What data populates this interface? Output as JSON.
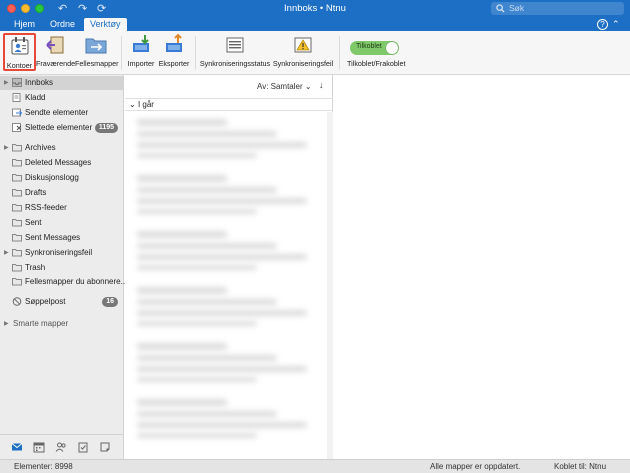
{
  "window": {
    "title": "Innboks • Ntnu",
    "search_placeholder": "Søk"
  },
  "tabs": [
    {
      "label": "Hjem",
      "active": false
    },
    {
      "label": "Ordne",
      "active": false
    },
    {
      "label": "Verktøy",
      "active": true
    }
  ],
  "ribbon": {
    "accounts": "Kontoer",
    "out_of_office": "Fraværende",
    "public_folders": "Fellesmapper",
    "import": "Importer",
    "export": "Eksporter",
    "sync_status": "Synkroniseringsstatus",
    "sync_errors": "Synkroniseringsfeil",
    "online_toggle": {
      "state_label": "Tilkoblet",
      "caption": "Tilkoblet/Frakoblet",
      "on": true
    }
  },
  "folders": [
    {
      "name": "Innboks",
      "icon": "inbox-icon",
      "selected": true,
      "disclosure": true,
      "badge": ""
    },
    {
      "name": "Kladd",
      "icon": "draft-icon",
      "selected": false,
      "disclosure": false,
      "badge": ""
    },
    {
      "name": "Sendte elementer",
      "icon": "sent-icon",
      "selected": false,
      "disclosure": false,
      "badge": ""
    },
    {
      "name": "Slettede elementer",
      "icon": "trash-icon",
      "selected": false,
      "disclosure": false,
      "badge": "1195"
    },
    {
      "name": "Archives",
      "icon": "folder-icon",
      "selected": false,
      "disclosure": true,
      "badge": ""
    },
    {
      "name": "Deleted Messages",
      "icon": "folder-icon",
      "selected": false,
      "disclosure": false,
      "badge": ""
    },
    {
      "name": "Diskusjonslogg",
      "icon": "folder-icon",
      "selected": false,
      "disclosure": false,
      "badge": ""
    },
    {
      "name": "Drafts",
      "icon": "folder-icon",
      "selected": false,
      "disclosure": false,
      "badge": ""
    },
    {
      "name": "RSS-feeder",
      "icon": "folder-icon",
      "selected": false,
      "disclosure": false,
      "badge": ""
    },
    {
      "name": "Sent",
      "icon": "folder-icon",
      "selected": false,
      "disclosure": false,
      "badge": ""
    },
    {
      "name": "Sent Messages",
      "icon": "folder-icon",
      "selected": false,
      "disclosure": false,
      "badge": ""
    },
    {
      "name": "Synkroniseringsfeil",
      "icon": "folder-icon",
      "selected": false,
      "disclosure": true,
      "badge": ""
    },
    {
      "name": "Trash",
      "icon": "folder-icon",
      "selected": false,
      "disclosure": false,
      "badge": ""
    },
    {
      "name": "Fellesmapper du abonnere...",
      "icon": "folder-icon",
      "selected": false,
      "disclosure": false,
      "badge": ""
    },
    {
      "name": "Søppelpost",
      "icon": "junk-icon",
      "selected": false,
      "disclosure": false,
      "badge": "16"
    }
  ],
  "smart_folders": "Smarte mapper",
  "message_list": {
    "sort_label": "Av: Samtaler",
    "group_header": "I går"
  },
  "status": {
    "item_count": "Elementer: 8998",
    "sync_message": "Alle mapper er oppdatert.",
    "connection": "Koblet til: Ntnu"
  },
  "colors": {
    "accent": "#1c6fc4",
    "highlight_border": "#e5493a",
    "toggle_on": "#7fc96a"
  }
}
